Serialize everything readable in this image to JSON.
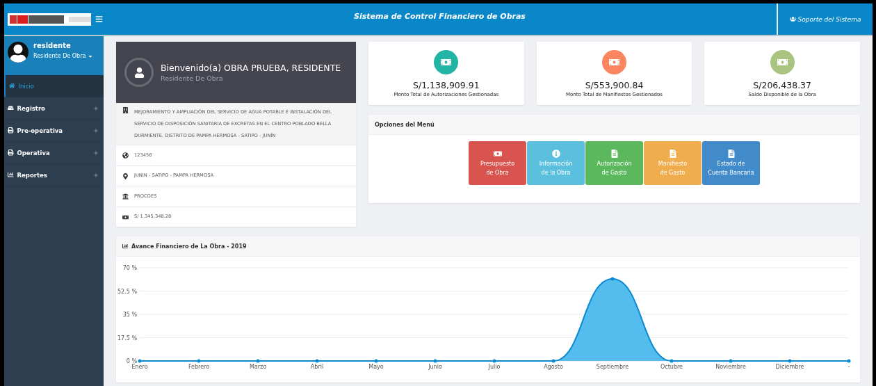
{
  "header": {
    "title": "Sistema de Control Financiero de Obras",
    "support": "Soporte del Sistema"
  },
  "user": {
    "name": "residente",
    "role": "Residente De Obra"
  },
  "sidebar": {
    "items": [
      {
        "label": "Inicio",
        "kind": "home",
        "selected": true,
        "expandable": false
      },
      {
        "label": "Registro",
        "kind": "drive",
        "selected": false,
        "expandable": true
      },
      {
        "label": "Pre-operativa",
        "kind": "print",
        "selected": false,
        "expandable": true
      },
      {
        "label": "Operativa",
        "kind": "print",
        "selected": false,
        "expandable": true
      },
      {
        "label": "Reportes",
        "kind": "chart",
        "selected": false,
        "expandable": true
      }
    ]
  },
  "profile": {
    "welcome": "Bienvenido(a) OBRA PRUEBA, RESIDENTE",
    "role": "Residente De Obra",
    "details": [
      {
        "kind": "building",
        "text": "MEJORAMIENTO Y AMPLIACIÓN DEL SERVICIO DE AGUA POTABLE E INSTALACIÓN DEL SERVICIO DE DISPOSICIÓN SANITARIA DE EXCRETAS EN EL CENTRO POBLADO BELLA DURMIENTE, DISTRITO DE PAMPA HERMOSA - SATIPO - JUNÍN"
      },
      {
        "kind": "globe",
        "text": "123456"
      },
      {
        "kind": "marker",
        "text": "JUNIN - SATIPO - PAMPA HERMOSA"
      },
      {
        "kind": "bank",
        "text": "PROCOES"
      },
      {
        "kind": "money",
        "text": "S/ 1,345,348.28"
      }
    ]
  },
  "stats": [
    {
      "amount": "S/1,138,909.91",
      "label": "Monto Total de Autorizaciones Gestionadas",
      "color": "#22b5a6"
    },
    {
      "amount": "S/553,900.84",
      "label": "Monto Total de Manifiestos Gestionados",
      "color": "#fb8461"
    },
    {
      "amount": "S/206,438.37",
      "label": "Saldo Disponible de la Obra",
      "color": "#a8c480"
    }
  ],
  "menu": {
    "title": "Opciones del Menú",
    "buttons": [
      {
        "kind": "money",
        "lines": [
          "Presupuesto",
          "de Obra"
        ],
        "color": "#d9534f"
      },
      {
        "kind": "info",
        "lines": [
          "Información",
          "de la Obra"
        ],
        "color": "#5bc0de"
      },
      {
        "kind": "file",
        "lines": [
          "Autorización",
          "de Gasto"
        ],
        "color": "#5cb85c"
      },
      {
        "kind": "file",
        "lines": [
          "Manifiesto",
          "de Gasto"
        ],
        "color": "#f0ad4e"
      },
      {
        "kind": "file",
        "lines": [
          "Estado de",
          "Cuenta Bancaria"
        ],
        "color": "#428bca"
      }
    ]
  },
  "chart": {
    "title": "Avance Financiero de La Obra - 2019",
    "chart_data": {
      "type": "area",
      "categories": [
        "Enero",
        "Febrero",
        "Marzo",
        "Abril",
        "Mayo",
        "Junio",
        "Julio",
        "Agosto",
        "Septiembre",
        "Octubre",
        "Noviembre",
        "Diciembre",
        "-"
      ],
      "grid": true,
      "series": [
        {
          "color": "#0b8ad4",
          "values": [
            0,
            0,
            0,
            0,
            0,
            0,
            0,
            0,
            61.6,
            0,
            0,
            0,
            0
          ]
        }
      ],
      "ylim": [
        0,
        70
      ],
      "yticks": [
        {
          "value": 0,
          "label": "0 %"
        },
        {
          "value": 17.5,
          "label": "17.5 %"
        },
        {
          "value": 35,
          "label": "35 %"
        },
        {
          "value": 52.5,
          "label": "52.5 %"
        },
        {
          "value": 70,
          "label": "70 %"
        }
      ]
    }
  }
}
